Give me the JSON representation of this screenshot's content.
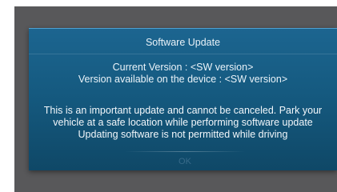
{
  "dialog": {
    "title": "Software Update",
    "current_version_line": "Current Version : <SW version>",
    "available_version_line": "Version available on the device : <SW version>",
    "message_lines": [
      "This is an important update and cannot be canceled. Park your",
      "vehicle at a safe location while performing software update",
      "Updating software is not permitted while driving"
    ],
    "ok_label": "OK",
    "ok_enabled": false
  },
  "colors": {
    "screen_background": "#58585a",
    "dialog_top": "#1c6590",
    "dialog_bottom": "#0f4867",
    "ok_disabled_text": "#386a89"
  }
}
